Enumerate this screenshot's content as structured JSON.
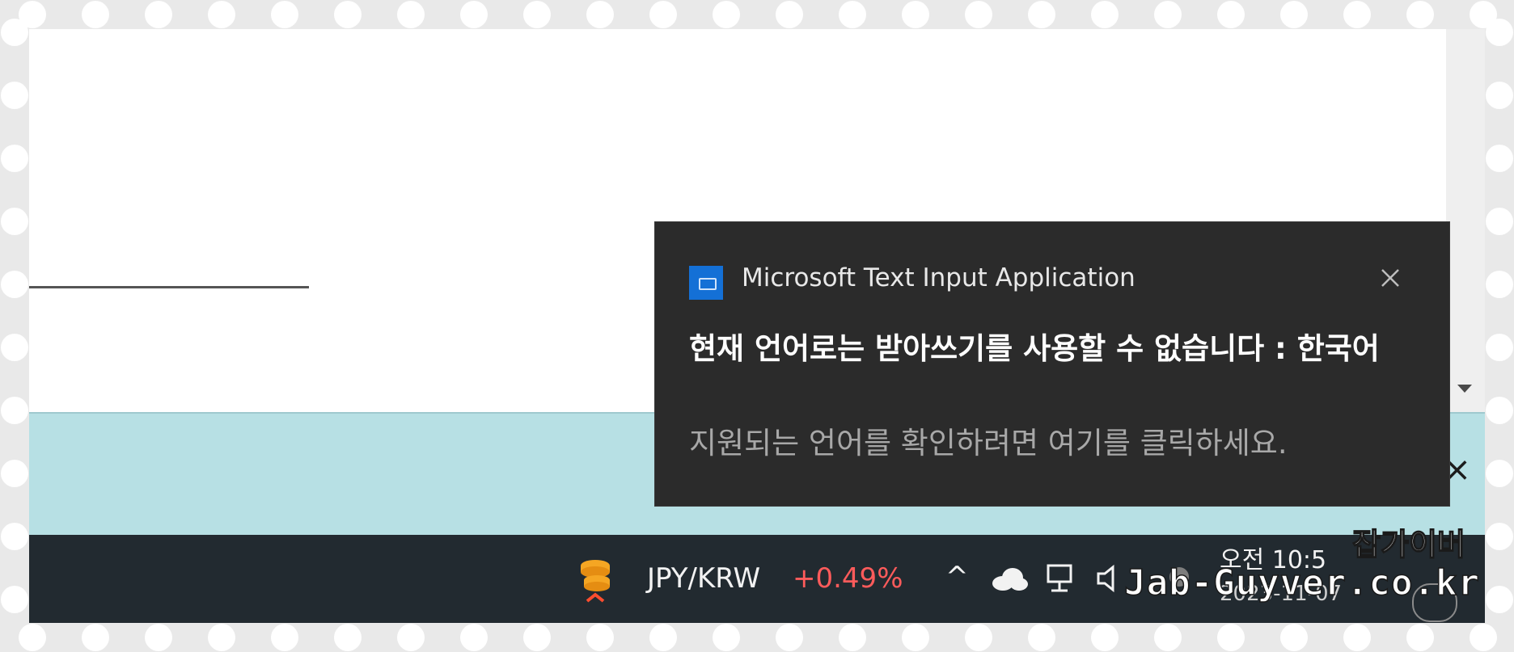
{
  "toast": {
    "app_name": "Microsoft Text Input Application",
    "title": "현재 언어로는 받아쓰기를 사용할 수 없습니다 : 한국어",
    "body": "지원되는 언어를 확인하려면 여기를 클릭하세요.",
    "icon": "keyboard-icon",
    "close_icon": "close-icon"
  },
  "taskbar": {
    "stock_pair": "JPY/KRW",
    "stock_change": "+0.49%",
    "stock_change_color": "#ff5b5b",
    "tray_chevron": "^",
    "tray_icons": [
      "cloud-icon",
      "network-icon",
      "volume-icon",
      "mute-icon"
    ],
    "clock_time": "오전 10:5",
    "clock_date": "2023-11-07"
  },
  "banner": {
    "close_symbol": "×",
    "color": "#b7e0e4"
  },
  "watermark": {
    "korean": "잡가이버",
    "url": "Jab-Guyver.co.kr"
  },
  "colors": {
    "toast_bg": "#2b2b2b",
    "taskbar_bg": "#222a30",
    "app_icon": "#1470d6"
  }
}
